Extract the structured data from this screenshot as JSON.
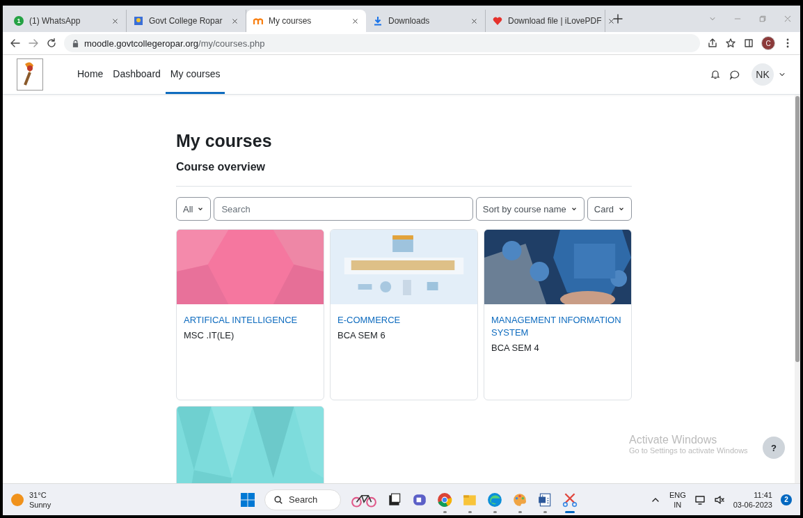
{
  "browser": {
    "tabs": [
      {
        "title": "(1) WhatsApp",
        "kind": "chat",
        "badge": "1",
        "selected": false
      },
      {
        "title": "Govt College Ropar",
        "kind": "site",
        "selected": false
      },
      {
        "title": "My courses",
        "kind": "moodle",
        "selected": true
      },
      {
        "title": "Downloads",
        "kind": "download",
        "selected": false
      },
      {
        "title": "Download file | iLovePDF",
        "kind": "heart",
        "selected": false
      }
    ],
    "address": {
      "host": "moodle.govtcollegeropar.org",
      "path": "/my/courses.php"
    },
    "profile": "C"
  },
  "navbar": {
    "items": [
      {
        "label": "Home",
        "selected": false
      },
      {
        "label": "Dashboard",
        "selected": false
      },
      {
        "label": "My courses",
        "selected": true
      }
    ],
    "user": "NK"
  },
  "page": {
    "title": "My courses",
    "section": "Course overview",
    "filter": "All",
    "search": {
      "placeholder": "Search"
    },
    "sort": "Sort by course name",
    "view": "Card",
    "courses": [
      {
        "name": "ARTIFICAL INTELLIGENCE",
        "category": "MSC .IT(LE)"
      },
      {
        "name": "E-COMMERCE",
        "category": "BCA SEM 6"
      },
      {
        "name": "MANAGEMENT INFORMATION SYSTEM",
        "category": "BCA SEM 4"
      },
      {
        "kind": "picture"
      }
    ]
  },
  "activation": {
    "title": "Activate Windows",
    "message": "Go to Settings to activate Windows"
  },
  "help_button": "?",
  "taskbar": {
    "weather": {
      "temp": "31°C",
      "condition": "Sunny"
    },
    "search": "Search",
    "apps": [
      {
        "kind": "bike",
        "running": false,
        "selected": false
      },
      {
        "kind": "tasks",
        "running": false,
        "selected": false
      },
      {
        "kind": "chat",
        "running": false,
        "selected": false
      },
      {
        "kind": "chrome",
        "running": true,
        "selected": false
      },
      {
        "kind": "folder",
        "running": true,
        "selected": false
      },
      {
        "kind": "edge",
        "running": true,
        "selected": false
      },
      {
        "kind": "paint",
        "running": true,
        "selected": false
      },
      {
        "kind": "word",
        "running": true,
        "selected": false
      },
      {
        "kind": "snip",
        "running": true,
        "selected": true
      }
    ],
    "language": "ENG",
    "region": "IN",
    "time": "11:41",
    "date": "03-06-2023",
    "notifications": "2"
  }
}
